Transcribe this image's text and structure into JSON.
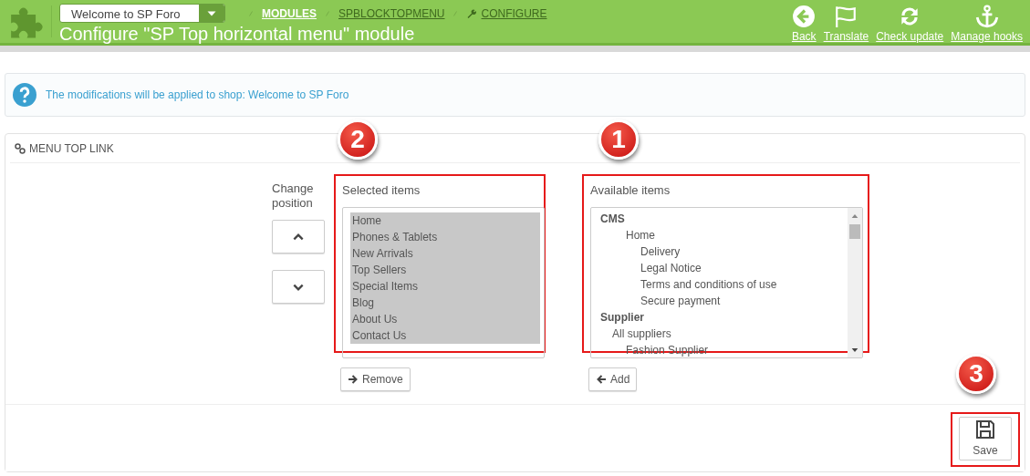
{
  "header": {
    "shop_select": {
      "value": "Welcome to SP Foro"
    },
    "breadcrumb": [
      {
        "label": "MODULES",
        "highlighted": true
      },
      {
        "label": "SPBLOCKTOPMENU",
        "highlighted": false
      },
      {
        "label": "CONFIGURE",
        "highlighted": false
      }
    ],
    "title": "Configure \"SP Top horizontal menu\" module",
    "toolbar": [
      {
        "label": "Back"
      },
      {
        "label": "Translate"
      },
      {
        "label": "Check update"
      },
      {
        "label": "Manage hooks"
      }
    ]
  },
  "alert": {
    "text": "The modifications will be applied to shop: Welcome to SP Foro"
  },
  "panel": {
    "title": "MENU TOP LINK",
    "change_position_label": "Change position",
    "selected": {
      "label": "Selected items",
      "marker": "2",
      "button": "Remove",
      "items": [
        {
          "label": "Home",
          "selected": true
        },
        {
          "label": "Phones & Tablets",
          "selected": true
        },
        {
          "label": "New Arrivals",
          "selected": true
        },
        {
          "label": "Top Sellers",
          "selected": true
        },
        {
          "label": "Special Items",
          "selected": true
        },
        {
          "label": "Blog",
          "selected": true
        },
        {
          "label": "About Us",
          "selected": true
        },
        {
          "label": "Contact Us",
          "selected": true
        }
      ]
    },
    "available": {
      "label": "Available items",
      "marker": "1",
      "button": "Add",
      "items": [
        {
          "label": "CMS",
          "kind": "group",
          "children": [
            {
              "label": "Home",
              "kind": "item",
              "children": [
                {
                  "label": "Delivery",
                  "kind": "item"
                },
                {
                  "label": "Legal Notice",
                  "kind": "item"
                },
                {
                  "label": "Terms and conditions of use",
                  "kind": "item"
                },
                {
                  "label": "Secure payment",
                  "kind": "item"
                }
              ]
            }
          ]
        },
        {
          "label": "Supplier",
          "kind": "group",
          "children": [
            {
              "label": "All suppliers",
              "kind": "item",
              "children": [
                {
                  "label": "Fashion Supplier",
                  "kind": "item"
                }
              ]
            }
          ]
        }
      ]
    },
    "save": {
      "label": "Save",
      "marker": "3"
    }
  }
}
